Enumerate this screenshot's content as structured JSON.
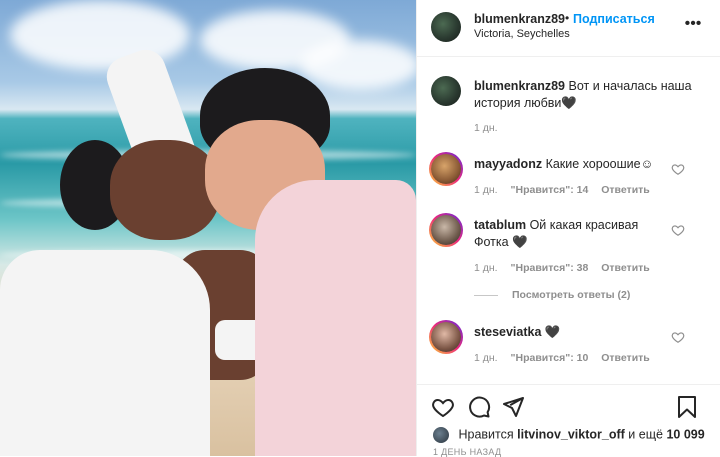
{
  "post": {
    "author": {
      "username": "blumenkranz89",
      "location": "Victoria, Seychelles"
    },
    "header": {
      "dot": "•",
      "follow_label": "Подписаться",
      "more_icon": "more-icon"
    },
    "caption": {
      "username": "blumenkranz89",
      "text": "Вот и началась наша история любви🖤",
      "time": "1 дн."
    },
    "comments": [
      {
        "username": "mayyadonz",
        "text": "Какие хороошие☺",
        "time": "1 дн.",
        "likes": "\"Нравится\": 14",
        "reply": "Ответить"
      },
      {
        "username": "tatablum",
        "text": "Ой какая красивая Фотка 🖤",
        "time": "1 дн.",
        "likes": "\"Нравится\": 38",
        "reply": "Ответить"
      },
      {
        "username": "steseviatka",
        "text": "🖤",
        "time": "1 дн.",
        "likes": "\"Нравится\": 10",
        "reply": "Ответить"
      }
    ],
    "view_replies": "Посмотреть ответы (2)",
    "likes_line": {
      "prefix": "Нравится",
      "user": "litvinov_viktor_off",
      "suffix": "и ещё",
      "count": "10 099"
    },
    "posted_ago": "1 ДЕНЬ НАЗАД",
    "icons": {
      "like": "heart-icon",
      "comment": "comment-icon",
      "share": "share-icon",
      "save": "bookmark-icon"
    },
    "colors": {
      "accent": "#0095f6",
      "text": "#262626",
      "muted": "#8e8e8e"
    }
  }
}
